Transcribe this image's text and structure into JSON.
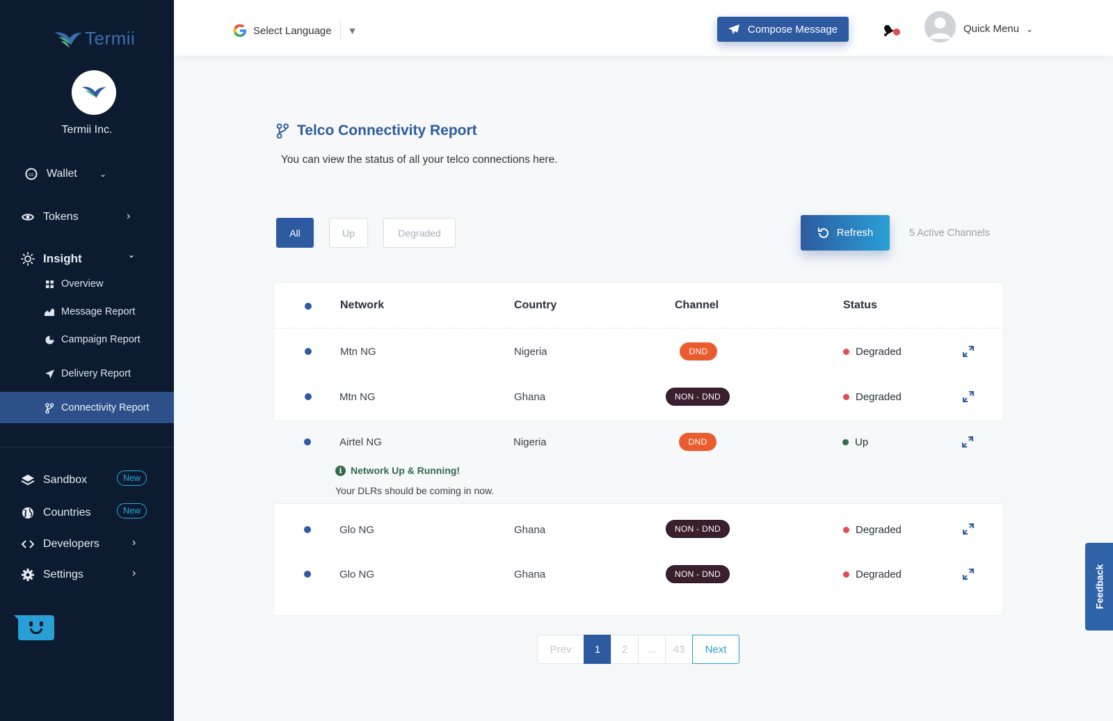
{
  "sidebar": {
    "brand": "Termii",
    "org_name": "Termii Inc.",
    "wallet": "Wallet",
    "tokens": "Tokens",
    "insight": "Insight",
    "overview": "Overview",
    "message_report": "Message Report",
    "campaign_report": "Campaign Report",
    "delivery_report": "Delivery Report",
    "connectivity_report": "Connectivity Report",
    "sandbox": "Sandbox",
    "countries": "Countries",
    "developers": "Developers",
    "settings": "Settings",
    "new_badge": "New"
  },
  "header": {
    "select_language": "Select Language",
    "compose": "Compose Message",
    "quick_menu": "Quick Menu"
  },
  "main": {
    "title": "Telco Connectivity Report",
    "description": "You can view the status of all your telco connections here.",
    "filters": [
      "All",
      "Up",
      "Degraded"
    ],
    "refresh": "Refresh",
    "active_channels": "5 Active Channels",
    "columns": {
      "network": "Network",
      "country": "Country",
      "channel": "Channel",
      "status": "Status"
    },
    "rows": [
      {
        "network": "Mtn NG",
        "country": "Nigeria",
        "channel": "DND",
        "status": "Degraded"
      },
      {
        "network": "Mtn NG",
        "country": "Ghana",
        "channel": "NON - DND",
        "status": "Degraded"
      },
      {
        "network": "Airtel NG",
        "country": "Nigeria",
        "channel": "DND",
        "status": "Up"
      },
      {
        "network": "Glo NG",
        "country": "Ghana",
        "channel": "NON - DND",
        "status": "Degraded"
      },
      {
        "network": "Glo NG",
        "country": "Ghana",
        "channel": "NON - DND",
        "status": "Degraded"
      }
    ],
    "expanded_note": {
      "title": "Network Up & Running!",
      "text": "Your DLRs should be coming in now."
    }
  },
  "pagination": {
    "prev": "Prev",
    "pages": [
      "1",
      "2",
      "...",
      "43"
    ],
    "next": "Next"
  },
  "feedback": "Feedback",
  "colors": {
    "sidebar_bg": "#0c1b2f",
    "brand_blue": "#2d5aa0",
    "accent_cyan": "#2a9fd6",
    "dnd_orange": "#ea5b2e",
    "nondnd_dark": "#3a1f2e",
    "degraded_red": "#e24c57",
    "up_green": "#2f6b4c"
  }
}
